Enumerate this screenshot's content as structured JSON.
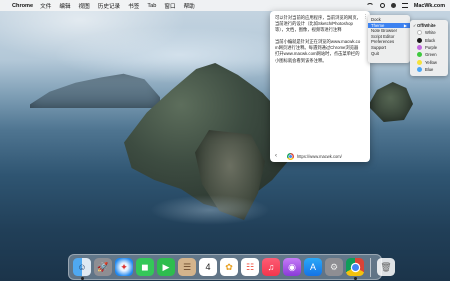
{
  "menubar": {
    "apple_glyph": "",
    "app_name": "Chrome",
    "menus": [
      "文件",
      "编辑",
      "视图",
      "历史记录",
      "书签",
      "Tab",
      "窗口",
      "帮助"
    ],
    "brand": "MacWk.com"
  },
  "note": {
    "paragraph1": "可以针对当前的应用程序，当前浏览的网页，当前进行的设计（比如Sketch/Photoshop等），文档，图像，视频等进行注释",
    "paragraph2": "当前小编就是针对正在浏览的www.macwk.com网页进行注释。每遇到通过Chrome浏览器打开www.macwk.com网站时，点击菜单栏的小图标就会看到该条注释。",
    "footer_url": "https://www.macwk.com/"
  },
  "context_menu": {
    "items": [
      {
        "label": "Dock",
        "selected": false,
        "submenu": false
      },
      {
        "label": "Theme",
        "selected": true,
        "submenu": true
      },
      {
        "label": "Note Browser",
        "selected": false,
        "submenu": false
      },
      {
        "label": "Script Editor",
        "selected": false,
        "submenu": false
      },
      {
        "label": "Preferences",
        "selected": false,
        "submenu": false
      },
      {
        "label": "Support",
        "selected": false,
        "submenu": false
      },
      {
        "label": "Quit",
        "selected": false,
        "submenu": false
      }
    ],
    "arrow_glyph": "▶"
  },
  "theme_submenu": {
    "check_glyph": "✓",
    "items": [
      {
        "label": "Off/White",
        "color": "",
        "checked": true
      },
      {
        "label": "White",
        "color": "#ffffff",
        "checked": false
      },
      {
        "label": "Black",
        "color": "#1a1a1a",
        "checked": false
      },
      {
        "label": "Purple",
        "color": "#c26ae0",
        "checked": false
      },
      {
        "label": "Green",
        "color": "#3ec93e",
        "checked": false
      },
      {
        "label": "Yellow",
        "color": "#f5e23a",
        "checked": false
      },
      {
        "label": "Blue",
        "color": "#4aa6f5",
        "checked": false
      }
    ]
  },
  "dock": {
    "apps": [
      {
        "name": "finder",
        "glyph": "☺",
        "bg": "linear-gradient(90deg,#4fa8f0 50%,#dfe9f3 50%)",
        "color": "#1c3a66",
        "running": true
      },
      {
        "name": "launchpad",
        "glyph": "🚀",
        "bg": "#8e8e93",
        "color": "#fff",
        "running": false
      },
      {
        "name": "safari",
        "glyph": "✦",
        "bg": "radial-gradient(circle,#eaf4ff 30%,#1e87f0 75%)",
        "color": "#d33",
        "running": false
      },
      {
        "name": "messages",
        "glyph": "◼",
        "bg": "#34c759",
        "color": "#fff",
        "running": false
      },
      {
        "name": "facetime",
        "glyph": "▶",
        "bg": "#2ebd4e",
        "color": "#fff",
        "running": false
      },
      {
        "name": "contacts",
        "glyph": "☰",
        "bg": "#d4b48c",
        "color": "#6b4a2b",
        "running": false
      },
      {
        "name": "calendar",
        "glyph": "4",
        "bg": "#ffffff",
        "color": "#222",
        "running": false
      },
      {
        "name": "photos",
        "glyph": "✿",
        "bg": "#ffffff",
        "color": "#e8a020",
        "running": false
      },
      {
        "name": "reminders",
        "glyph": "☷",
        "bg": "#ffffff",
        "color": "#f05040",
        "running": false
      },
      {
        "name": "music",
        "glyph": "♫",
        "bg": "linear-gradient(180deg,#fb5c74,#f4364c)",
        "color": "#fff",
        "running": false
      },
      {
        "name": "podcasts",
        "glyph": "◉",
        "bg": "linear-gradient(180deg,#c57bf7,#8a3ad8)",
        "color": "#fff",
        "running": false
      },
      {
        "name": "app-store",
        "glyph": "A",
        "bg": "linear-gradient(180deg,#2aa8f8,#1573e6)",
        "color": "#fff",
        "running": false
      },
      {
        "name": "system-preferences",
        "glyph": "⚙",
        "bg": "#8e8e93",
        "color": "#eee",
        "running": false
      },
      {
        "name": "chrome",
        "glyph": "",
        "bg": "conic-gradient(#db4437 0deg 120deg,#f4c20d 120deg 240deg,#0f9d58 240deg 360deg)",
        "color": "#fff",
        "running": true
      }
    ],
    "trash": {
      "name": "trash",
      "glyph": "🗑",
      "bg": "rgba(255,255,255,0.85)",
      "color": "#666"
    }
  }
}
